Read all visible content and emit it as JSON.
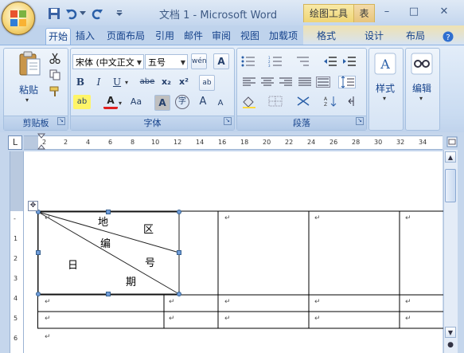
{
  "window": {
    "title": "文档 1 - Microsoft Word",
    "context_tools": "绘图工具",
    "context_table": "表",
    "minimize": "–",
    "maximize": "□",
    "close": "✕"
  },
  "tabs": [
    "开始",
    "插入",
    "页面布局",
    "引用",
    "邮件",
    "审阅",
    "视图",
    "加载项",
    "格式",
    "设计",
    "布局"
  ],
  "active_tab": "开始",
  "clipboard": {
    "label": "剪贴板",
    "paste": "粘贴"
  },
  "font": {
    "label": "字体",
    "name": "宋体 (中文正文",
    "size": "五号",
    "buttons": {
      "bold": "B",
      "italic": "I",
      "underline": "U",
      "strike": "abe",
      "subscript": "x₂",
      "superscript": "x²",
      "font_color": "A",
      "change_case": "Aa",
      "char_shading": "A",
      "enclose": "字",
      "grow": "A",
      "shrink": "A"
    }
  },
  "paragraph": {
    "label": "段落"
  },
  "styles": {
    "label": "样式"
  },
  "editing": {
    "label": "编辑"
  },
  "ruler": {
    "h_ticks": [
      "2",
      "2",
      "4",
      "6",
      "8",
      "10",
      "12",
      "14",
      "16",
      "18",
      "20",
      "22",
      "24",
      "26",
      "28",
      "30",
      "32",
      "34"
    ],
    "v_ticks": [
      "1",
      "2",
      "3",
      "4",
      "5",
      "6"
    ]
  },
  "table": {
    "diagonal_labels": [
      "地",
      "区",
      "编",
      "号",
      "日",
      "期"
    ],
    "cell_mark": "↵"
  },
  "colors": {
    "accent": "#15428b",
    "ribbon_bg": "#c9dbf1",
    "handle": "#6f9bd8"
  }
}
